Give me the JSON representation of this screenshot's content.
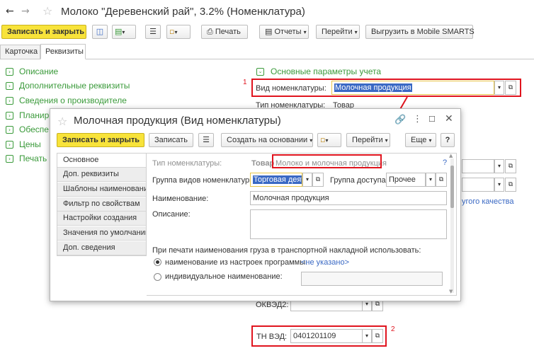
{
  "window": {
    "title": "Молоко \"Деревенский рай\", 3.2% (Номенклатура)"
  },
  "toolbar": {
    "save_close": "Записать и закрыть",
    "print": "Печать",
    "reports": "Отчеты",
    "goto": "Перейти",
    "upload": "Выгрузить в Mobile SMARTS"
  },
  "tabs": [
    "Карточка",
    "Реквизиты"
  ],
  "left_sections": [
    "Описание",
    "Дополнительные реквизиты",
    "Сведения о производителе",
    "Планир",
    "Обеспе",
    "Цены",
    "Печать"
  ],
  "params": {
    "header": "Основные параметры учета",
    "kind_label": "Вид номенклатуры:",
    "kind_value": "Молочная продукция",
    "type_label": "Тип номенклатуры:",
    "type_value": "Товар",
    "quality_link": "угого качества",
    "okved_label": "ОКВЭД2:",
    "tnved_label": "ТН ВЭД:",
    "tnved_value": "0401201109"
  },
  "annotations": {
    "n1": "1",
    "n2": "2"
  },
  "dialog": {
    "title": "Молочная продукция (Вид номенклатуры)",
    "save_close": "Записать и закрыть",
    "save": "Записать",
    "create_basis": "Создать на основании",
    "goto": "Перейти",
    "more": "Еще",
    "help": "?",
    "nav": [
      "Основное",
      "Доп. реквизиты",
      "Шаблоны наименований",
      "Фильтр по свойствам",
      "Настройки создания",
      "Значения по умолчанию",
      "Доп. сведения"
    ],
    "type_label": "Тип номенклатуры:",
    "type_value": "Товар",
    "type_hint": "Молоко и молочная продукция",
    "group_label": "Группа видов номенклатуры:",
    "group_value": "Торговая деят",
    "access_label": "Группа доступа:",
    "access_value": "Прочее",
    "name_label": "Наименование:",
    "name_value": "Молочная продукция",
    "desc_label": "Описание:",
    "print_text": "При печати наименования груза в транспортной накладной использовать:",
    "radio1": "наименование из настроек программы:",
    "radio1_value": "<не указано>",
    "radio2": "индивидуальное наименование:"
  }
}
